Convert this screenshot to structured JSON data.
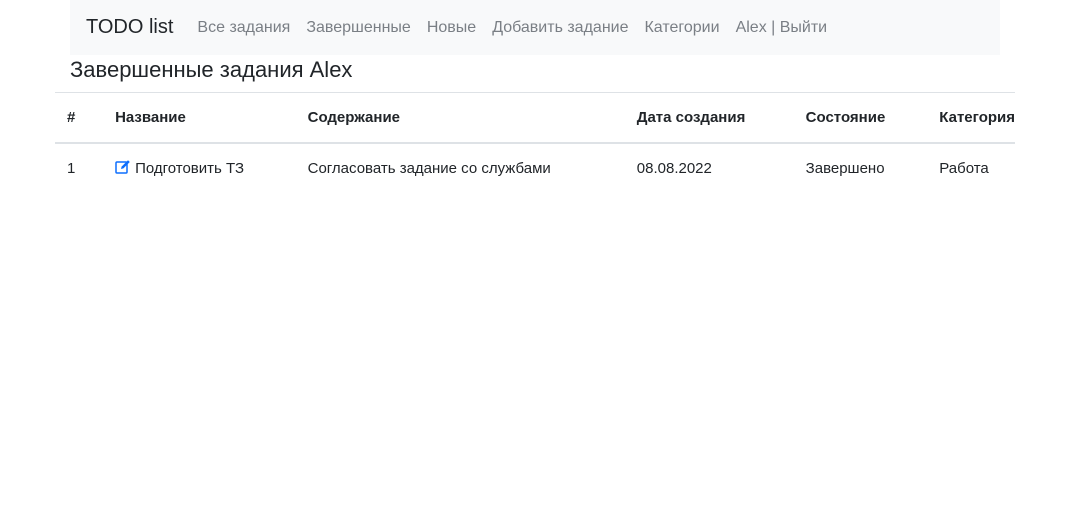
{
  "nav": {
    "brand": "TODO list",
    "links": [
      {
        "label": "Все задания"
      },
      {
        "label": "Завершенные"
      },
      {
        "label": "Новые"
      },
      {
        "label": "Добавить задание"
      },
      {
        "label": "Категории"
      },
      {
        "label": "Alex | Выйти"
      }
    ]
  },
  "page": {
    "title": "Завершенные задания Alex"
  },
  "table": {
    "headers": [
      "#",
      "Название",
      "Содержание",
      "Дата создания",
      "Состояние",
      "Категория"
    ],
    "rows": [
      {
        "num": "1",
        "name": "Подготовить ТЗ",
        "name_icon": "edit-icon",
        "content": "Согласовать задание со службами",
        "date": "08.08.2022",
        "state": "Завершено",
        "category": "Работа"
      }
    ]
  },
  "colors": {
    "navbar_bg": "#f8f9fa",
    "link": "#7a7f85",
    "icon": "#0d6efd"
  }
}
